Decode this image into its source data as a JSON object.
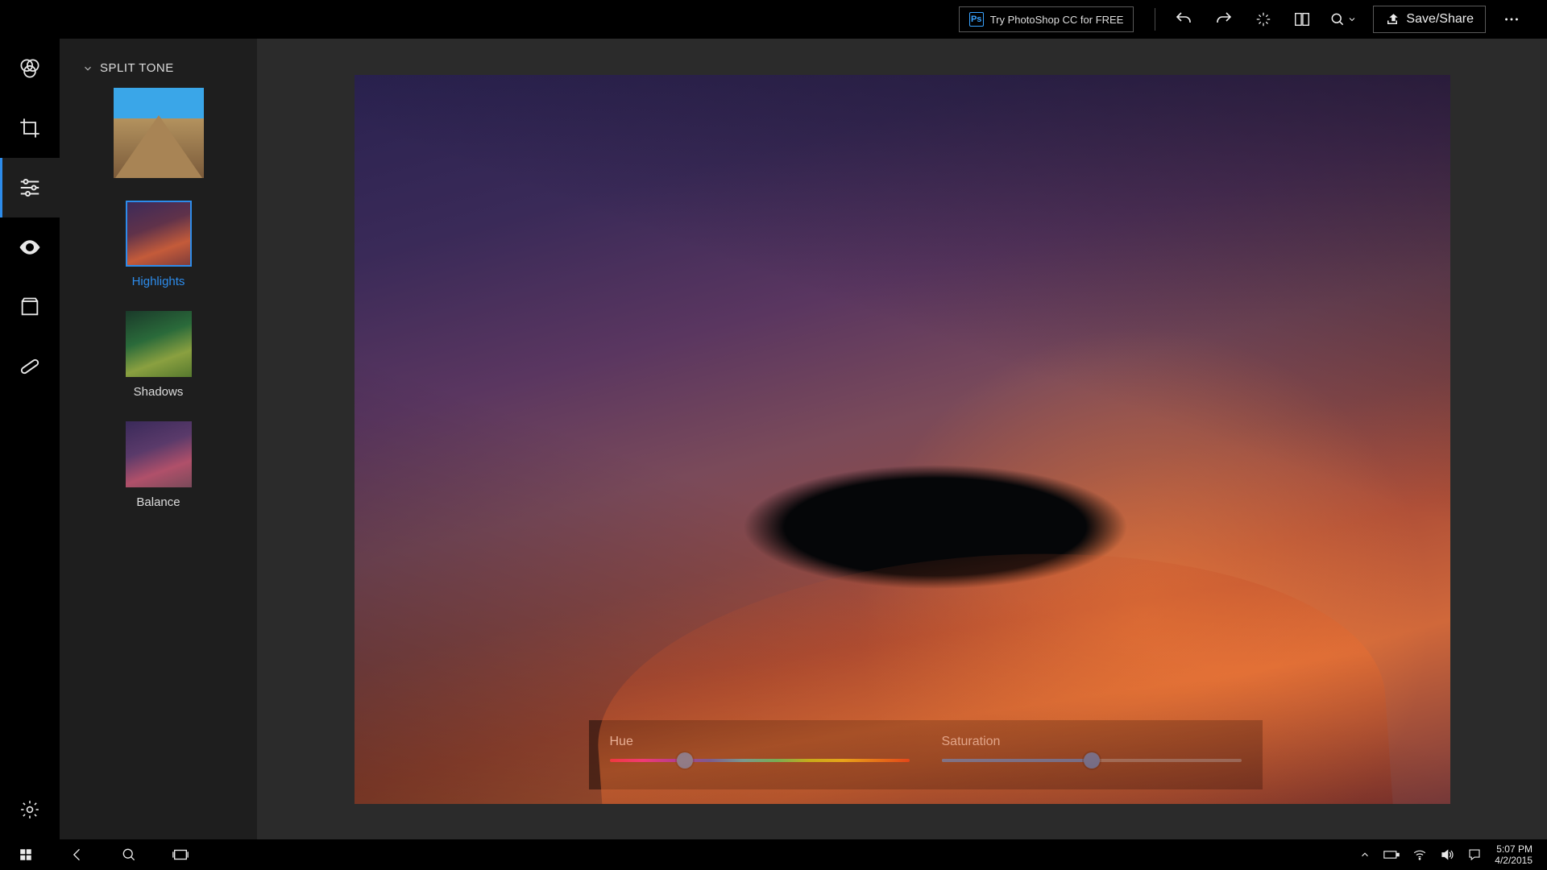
{
  "topbar": {
    "try_label": "Try PhotoShop CC for FREE",
    "ps_badge": "Ps",
    "save_share_label": "Save/Share"
  },
  "panel": {
    "title": "SPLIT TONE",
    "options": [
      {
        "label": "Highlights",
        "selected": true,
        "thumb": "t-highlights"
      },
      {
        "label": "Shadows",
        "selected": false,
        "thumb": "t-shadows"
      },
      {
        "label": "Balance",
        "selected": false,
        "thumb": "t-balance"
      }
    ]
  },
  "hud": {
    "hue": {
      "label": "Hue",
      "percent": 25
    },
    "saturation": {
      "label": "Saturation",
      "percent": 50
    }
  },
  "rail": {
    "items": [
      "filters",
      "crop",
      "adjust",
      "redeye",
      "frames",
      "heal"
    ],
    "active": "adjust"
  },
  "taskbar": {
    "time": "5:07 PM",
    "date": "4/2/2015"
  },
  "colors": {
    "accent": "#2d8ceb"
  }
}
